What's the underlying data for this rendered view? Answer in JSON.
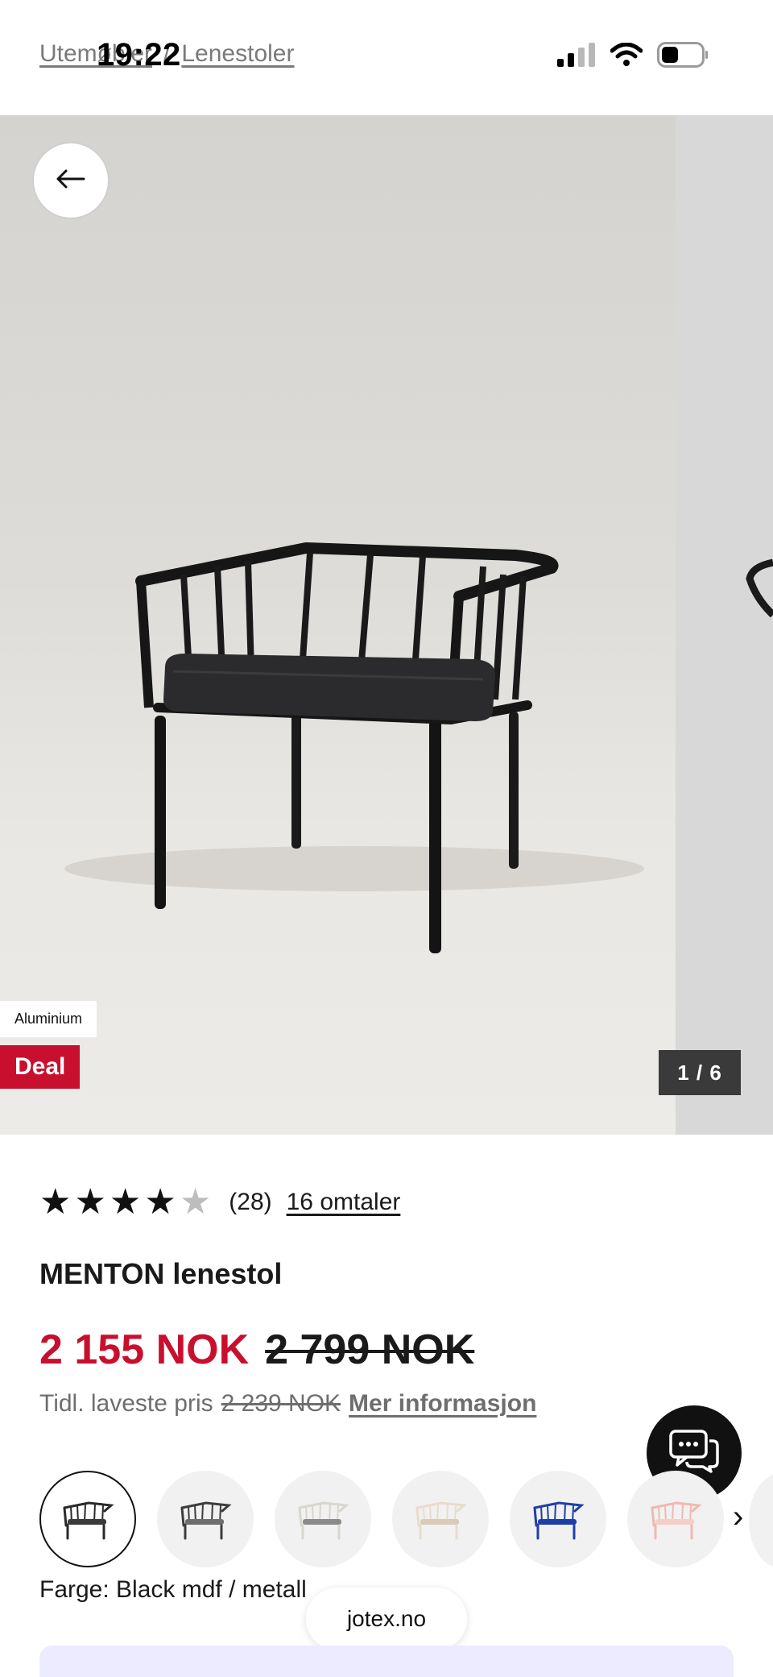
{
  "status_bar": {
    "time": "19:22"
  },
  "breadcrumb": {
    "parent": "Utemøbler",
    "separator": "/",
    "current": "Lenestoler"
  },
  "gallery": {
    "material_tag": "Aluminium",
    "deal_tag": "Deal",
    "counter": "1 / 6"
  },
  "rating": {
    "stars": 4,
    "max_stars": 5,
    "count": "(28)",
    "reviews_link": "16 omtaler"
  },
  "product": {
    "title": "MENTON lenestol"
  },
  "price": {
    "current": "2 155 NOK",
    "original": "2 799 NOK",
    "lowest_label": "Tidl. laveste pris",
    "lowest_value": "2 239 NOK",
    "more_info": "Mer informasjon"
  },
  "swatches": [
    {
      "name": "Black mdf / metall",
      "frame_color": "#2a2a2a",
      "seat_color": "#3a3a3a",
      "selected": true
    },
    {
      "name": "Grey",
      "frame_color": "#3d3d3d",
      "seat_color": "#6e6e6e",
      "selected": false
    },
    {
      "name": "White",
      "frame_color": "#d9d6cf",
      "seat_color": "#8a8a8a",
      "selected": false
    },
    {
      "name": "Beige",
      "frame_color": "#e8dccb",
      "seat_color": "#d8ccb8",
      "selected": false
    },
    {
      "name": "Blue",
      "frame_color": "#1f3fa8",
      "seat_color": "#1f3fa8",
      "selected": false
    },
    {
      "name": "Pink",
      "frame_color": "#f0b9b0",
      "seat_color": "#f3cfc8",
      "selected": false
    }
  ],
  "color": {
    "label": "Farge: Black mdf / metall"
  },
  "browser": {
    "url": "jotex.no"
  },
  "colors": {
    "accent_red": "#c8102e",
    "chat_bg": "#111111"
  }
}
